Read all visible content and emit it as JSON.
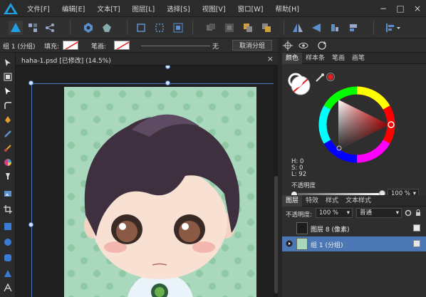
{
  "menubar": {
    "items": [
      "文件[F]",
      "编辑[E]",
      "文本[T]",
      "图层[L]",
      "选择[S]",
      "视图[V]",
      "窗口[W]",
      "帮助[H]"
    ],
    "window_controls": [
      "−",
      "□",
      "×"
    ]
  },
  "context": {
    "group_label": "组 1 (分组)",
    "fill_label": "填充:",
    "stroke_label": "笔画:",
    "stroke_width": "无",
    "ungroup_label": "取消分组"
  },
  "document": {
    "tab_label": "haha-1.psd [已修改] (14.5%)",
    "close": "×"
  },
  "color_panel": {
    "tabs": [
      "颜色",
      "样本条",
      "笔画",
      "画笔"
    ],
    "active_tab": "颜色",
    "h_label": "H: 0",
    "s_label": "S: 0",
    "l_label": "L: 92",
    "opacity_label": "不透明度",
    "opacity_value": "100 %",
    "accent_color": "#e02020"
  },
  "layers_panel": {
    "tabs": [
      "图层",
      "特效",
      "样式",
      "文本样式"
    ],
    "active_tab": "图层",
    "opacity_label": "不透明度:",
    "opacity_value": "100 %",
    "blend_mode": "普通",
    "layers": [
      {
        "name": "图层 8 (像素)"
      },
      {
        "name": "组 1 (分组)"
      }
    ]
  }
}
